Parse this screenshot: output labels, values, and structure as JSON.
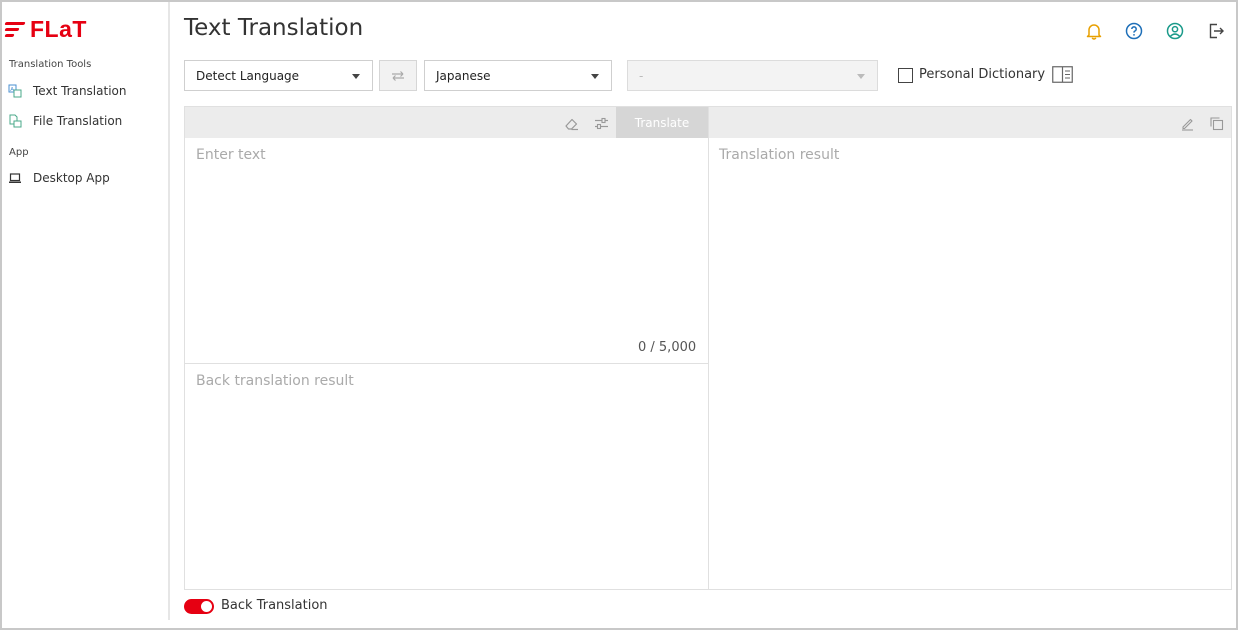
{
  "brand": {
    "name": "FLaT",
    "color": "#e60012"
  },
  "sidebar": {
    "sections": [
      {
        "title": "Translation Tools",
        "items": [
          {
            "label": "Text Translation",
            "icon": "text-translation-icon"
          },
          {
            "label": "File Translation",
            "icon": "file-translation-icon"
          }
        ]
      },
      {
        "title": "App",
        "items": [
          {
            "label": "Desktop App",
            "icon": "laptop-icon"
          }
        ]
      }
    ]
  },
  "header": {
    "title": "Text Translation",
    "icons": [
      "bell-icon",
      "help-icon",
      "account-icon",
      "logout-icon"
    ],
    "icon_colors": {
      "bell": "#e8a000",
      "help": "#1e6fb8",
      "account": "#1a9a8a",
      "logout": "#444444"
    }
  },
  "toolbar": {
    "source_language": "Detect Language",
    "target_language": "Japanese",
    "field_select": "-",
    "personal_dictionary_label": "Personal Dictionary",
    "personal_dictionary_checked": false
  },
  "editor": {
    "translate_label": "Translate",
    "source_placeholder": "Enter text",
    "char_counter": "0 / 5,000",
    "result_placeholder": "Translation result",
    "back_translation_placeholder": "Back translation result"
  },
  "footer": {
    "back_translation_label": "Back Translation",
    "back_translation_enabled": true
  }
}
